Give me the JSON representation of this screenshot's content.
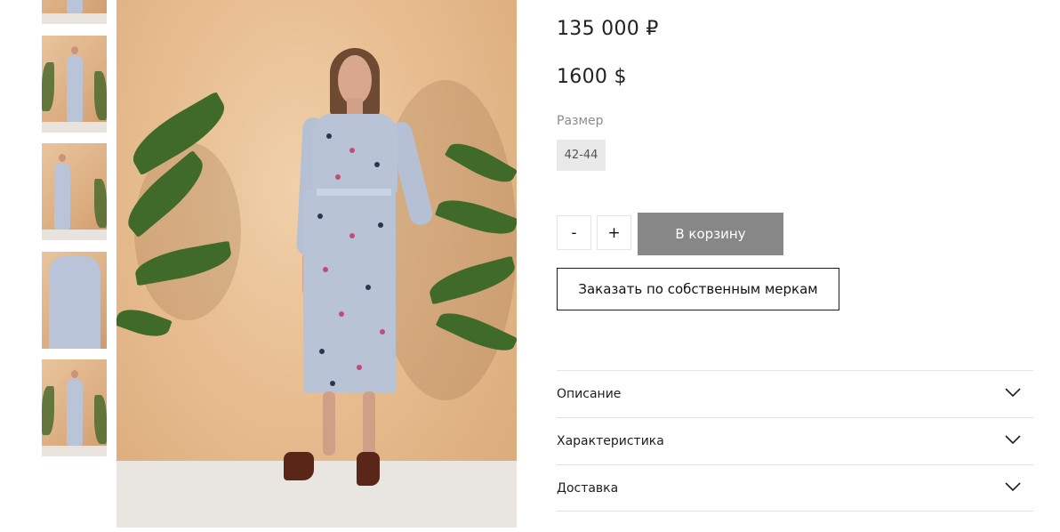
{
  "gallery": {
    "thumbnails": [
      {
        "alt": "thumb-1"
      },
      {
        "alt": "thumb-2"
      },
      {
        "alt": "thumb-3"
      },
      {
        "alt": "thumb-4"
      },
      {
        "alt": "thumb-5"
      },
      {
        "alt": "thumb-6"
      }
    ]
  },
  "product": {
    "price_rub": "135 000 ₽",
    "price_usd": "1600 $",
    "size_label": "Размер",
    "size_selected": "42-44",
    "qty_minus": "-",
    "qty_plus": "+",
    "add_to_cart": "В корзину",
    "custom_order": "Заказать по собственным меркам"
  },
  "accordion": [
    {
      "label": "Описание",
      "icon": "chevron-down-icon"
    },
    {
      "label": "Характеристика",
      "icon": "chevron-down-icon"
    },
    {
      "label": "Доставка",
      "icon": "chevron-down-icon"
    }
  ],
  "colors": {
    "cart_button": "#878787",
    "size_chip": "#e9e9e9",
    "divider": "#e3e3e3",
    "text": "#1d1d1d"
  }
}
